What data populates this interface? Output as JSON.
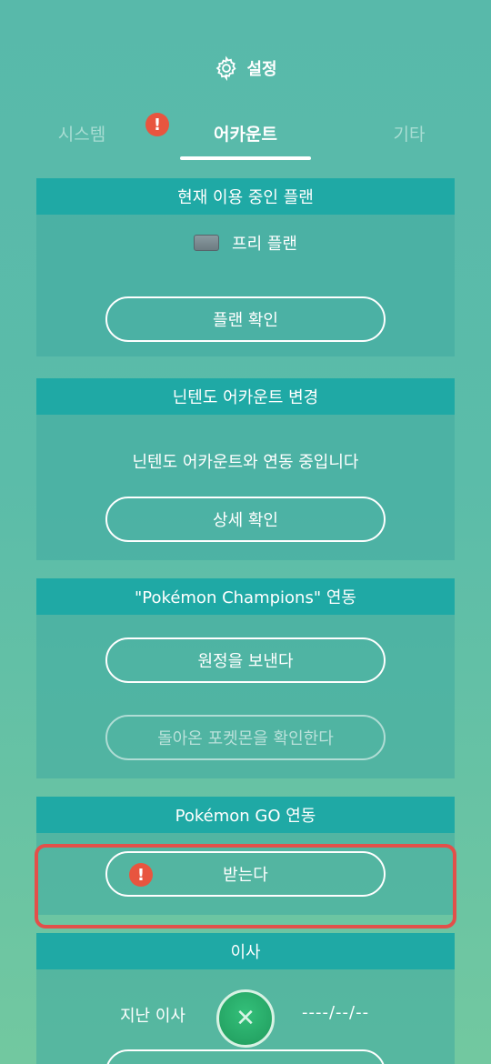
{
  "header": {
    "title": "설정",
    "icon": "gear-icon"
  },
  "tabs": [
    {
      "label": "시스템",
      "alert": true
    },
    {
      "label": "어카운트",
      "active": true
    },
    {
      "label": "기타"
    }
  ],
  "alert_glyph": "!",
  "sections": {
    "plan": {
      "title": "현재 이용 중인 플랜",
      "plan_name": "프리 플랜",
      "button": "플랜 확인"
    },
    "nintendo": {
      "title": "닌텐도 어카운트 변경",
      "message": "닌텐도 어카운트와 연동 중입니다",
      "button": "상세 확인"
    },
    "champions": {
      "title": "\"Pokémon Champions\" 연동",
      "button_send": "원정을 보낸다",
      "button_check": "돌아온 포켓몬을 확인한다"
    },
    "go": {
      "title": "Pokémon GO 연동",
      "button": "받는다"
    },
    "move": {
      "title": "이사",
      "last_label": "지난 이사",
      "last_date": "----/--/--",
      "move_glyph": "✕"
    }
  },
  "colors": {
    "accent": "#1fa9a5",
    "alert": "#e8553f",
    "highlight": "#e2504a",
    "move_button": "#2fb06c"
  }
}
